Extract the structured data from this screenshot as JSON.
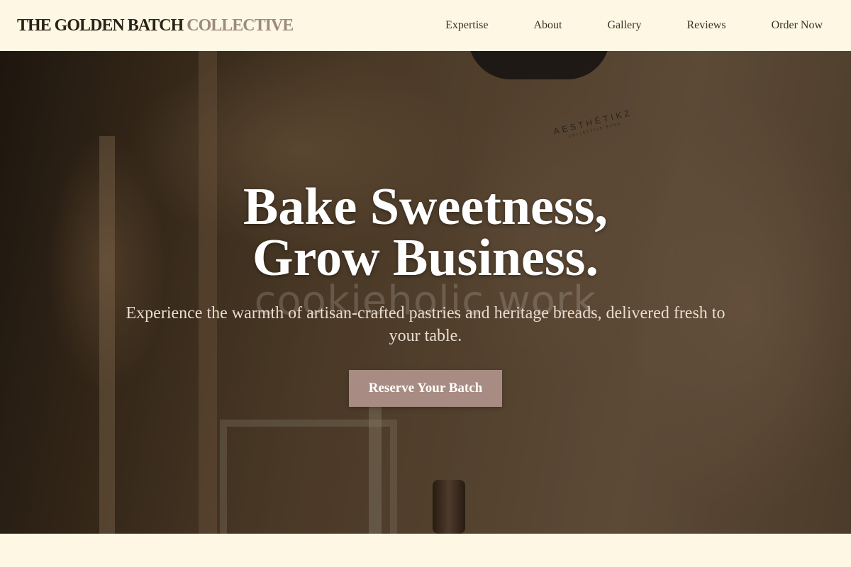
{
  "brand": {
    "name_main": "THE GOLDEN BATCH",
    "name_accent": "COLLECTIVE"
  },
  "nav": {
    "items": [
      {
        "label": "Expertise"
      },
      {
        "label": "About"
      },
      {
        "label": "Gallery"
      },
      {
        "label": "Reviews"
      },
      {
        "label": "Order Now"
      }
    ]
  },
  "hero": {
    "title_line1": "Bake Sweetness,",
    "title_line2": "Grow Business.",
    "watermark": "cookieholic work",
    "subtitle": "Experience the warmth of artisan-crafted pastries and heritage breads, delivered fresh to your table.",
    "cta_label": "Reserve Your Batch",
    "shirt_print_main": "AESTHÉTIKZ",
    "shirt_print_sub": "COLLECTIVE BAND"
  },
  "colors": {
    "page_background": "#fdf7e3",
    "brand_dark": "#2b2118",
    "brand_accent": "#9c8a80",
    "cta_background": "#a88c83"
  }
}
